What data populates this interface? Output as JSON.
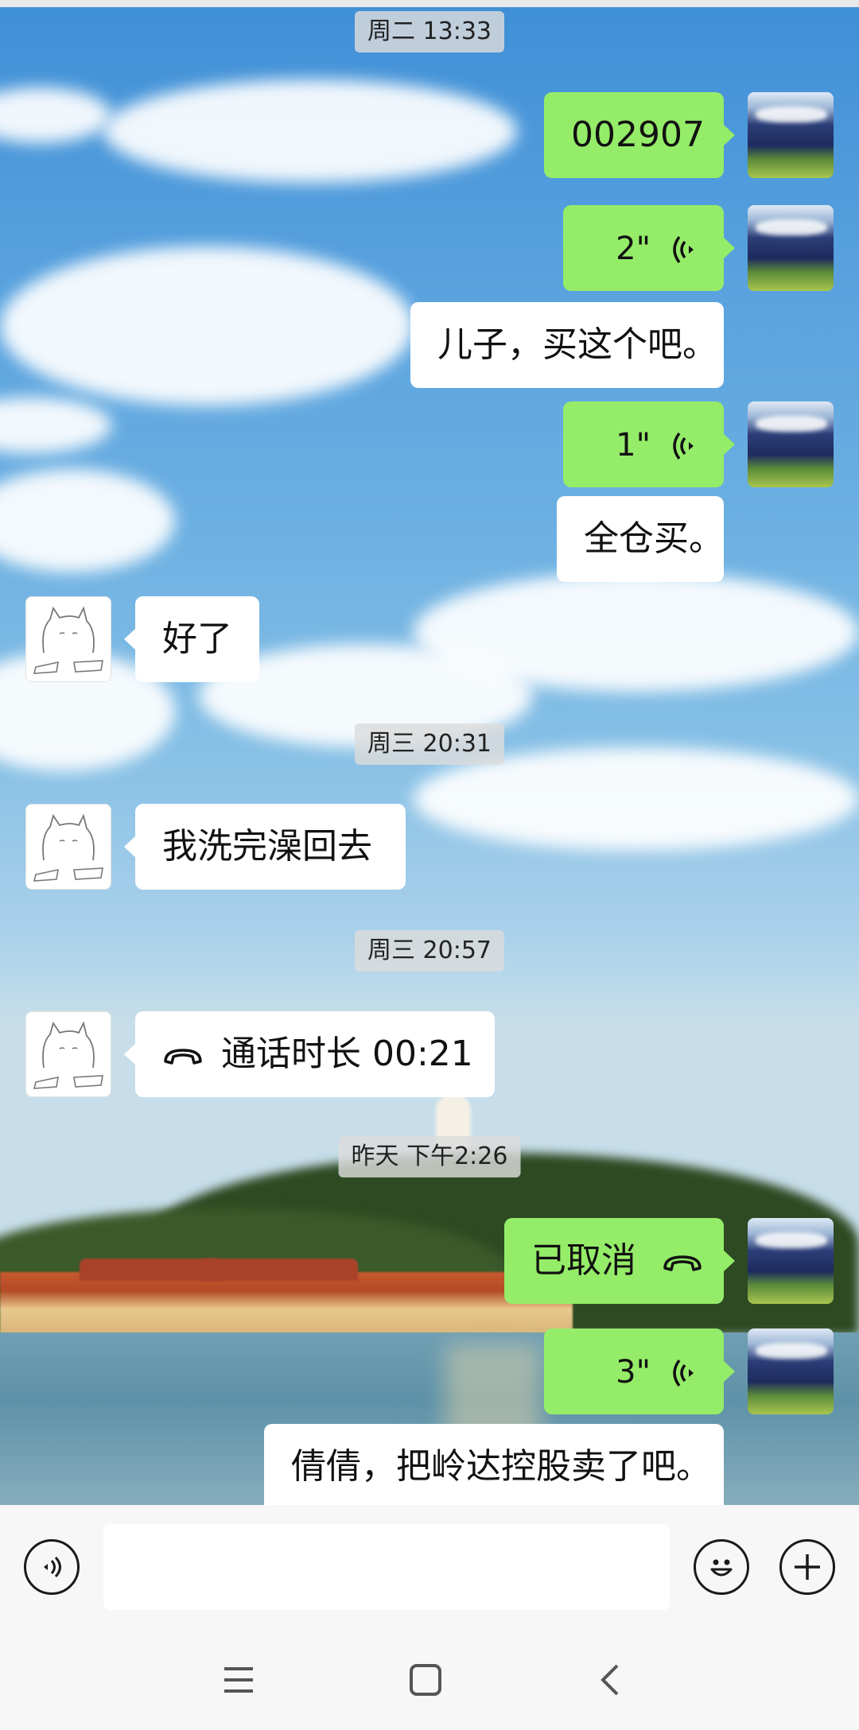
{
  "timestamps": [
    "周二 13:33",
    "周三 20:31",
    "周三 20:57",
    "昨天 下午2:26"
  ],
  "messages": [
    {
      "side": "self",
      "type": "text",
      "text": "002907"
    },
    {
      "side": "self",
      "type": "voice",
      "duration": "2\""
    },
    {
      "side": "self",
      "type": "text",
      "text": "儿子，买这个吧。"
    },
    {
      "side": "self",
      "type": "voice",
      "duration": "1\""
    },
    {
      "side": "self",
      "type": "text",
      "text": "全仓买。"
    },
    {
      "side": "other",
      "type": "text",
      "text": "好了"
    },
    {
      "side": "other",
      "type": "text",
      "text": "我洗完澡回去"
    },
    {
      "side": "other",
      "type": "call",
      "text": "通话时长 00:21"
    },
    {
      "side": "self",
      "type": "call",
      "text": "已取消"
    },
    {
      "side": "self",
      "type": "voice",
      "duration": "3\""
    },
    {
      "side": "self",
      "type": "text",
      "text": "倩倩，把岭达控股卖了吧。"
    }
  ],
  "icons": {
    "voice_msg": "voice-wave-icon",
    "call": "phone-hangup-icon",
    "input_voice": "voice-input-icon",
    "emoji": "emoji-icon",
    "more": "plus-icon",
    "nav_menu": "menu-icon",
    "nav_home": "home-square-icon",
    "nav_back": "back-chevron-icon"
  },
  "input": {
    "value": ""
  },
  "colors": {
    "self_bubble": "#95ec69",
    "other_bubble": "#ffffff",
    "timestamp_bg": "#dcdcdc"
  }
}
